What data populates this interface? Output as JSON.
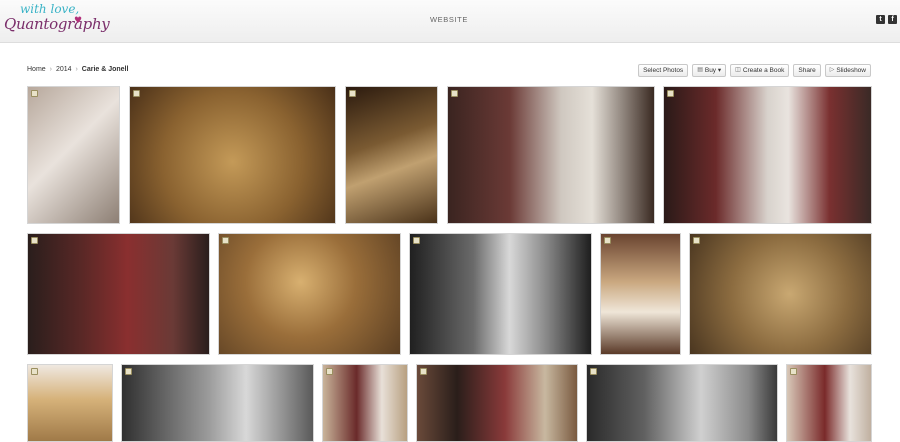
{
  "header": {
    "logo_line1": "with love,",
    "logo_line2": "Quantography",
    "nav_label": "WEBSITE",
    "social": [
      {
        "icon": "twitter-icon",
        "glyph": "t"
      },
      {
        "icon": "facebook-icon",
        "glyph": "f"
      }
    ]
  },
  "breadcrumb": {
    "home": "Home",
    "year": "2014",
    "gallery": "Carie & Jonell",
    "separator": "›"
  },
  "toolbar": {
    "select_photos": "Select Photos",
    "buy": "Buy ▾",
    "create_book": "Create a Book",
    "share": "Share",
    "slideshow": "Slideshow"
  },
  "colors": {
    "logo_teal": "#3ab3c6",
    "logo_plum": "#7b2f6b",
    "button_border": "#c8c8c8"
  },
  "photos": [
    {
      "name": "photo-bridal-shoes",
      "bg": "linear-gradient(135deg,#b7a89c 0%,#e9e2dc 45%,#8d7f74 100%)"
    },
    {
      "name": "photo-earrings-on-fabric",
      "bg": "radial-gradient(circle at 50% 55%,#c49a58 0%,#8a6230 55%,#4a3018 100%)"
    },
    {
      "name": "photo-jeweled-clutch",
      "bg": "linear-gradient(160deg,#2b1a0e 0%,#7a5a32 40%,#c0a070 60%,#4a3219 100%)"
    },
    {
      "name": "photo-bridesmaid-and-bride-closet",
      "bg": "linear-gradient(90deg,#3a2420 0%,#6b3a36 30%,#cfc8c0 55%,#e5e0d8 70%,#3a2a22 100%)"
    },
    {
      "name": "photo-bridesmaids-dressing",
      "bg": "linear-gradient(90deg,#2a1a18 0%,#6b2a2a 25%,#d8d2cc 50%,#e9e4df 60%,#7a3030 80%,#3a2a26 100%)"
    },
    {
      "name": "photo-bridesmaid-red-dress",
      "bg": "linear-gradient(90deg,#2a1e1c 0%,#5a2826 30%,#8a2f2f 55%,#6a3a36 80%,#2a1e1c 100%)"
    },
    {
      "name": "photo-sparkling-detail-one",
      "bg": "radial-gradient(circle at 45% 40%,#d8b070 0%,#9a6e3a 45%,#5a3e22 100%)"
    },
    {
      "name": "photo-bw-bride-helping",
      "bg": "linear-gradient(90deg,#202020 0%,#6a6a6a 35%,#d8d8d8 55%,#8a8a8a 75%,#1e1e1e 100%)"
    },
    {
      "name": "photo-wedding-gown-hanging",
      "bg": "linear-gradient(180deg,#6a4430 0%,#caa880 40%,#efe6d8 65%,#5a3a28 100%)"
    },
    {
      "name": "photo-sparkling-detail-two",
      "bg": "radial-gradient(circle at 55% 50%,#c9a872 0%,#8c6c40 50%,#4a3620 100%)"
    },
    {
      "name": "photo-gown-bodice",
      "bg": "linear-gradient(180deg,#efe8e0 0%,#d6b27a 45%,#a07a48 100%)"
    },
    {
      "name": "photo-bw-bride-seated",
      "bg": "linear-gradient(90deg,#303030 0%,#9a9a9a 45%,#d8d8d8 65%,#5a5a5a 100%)"
    },
    {
      "name": "photo-bride-and-flower-girl",
      "bg": "linear-gradient(90deg,#c9b49a 0%,#6a2a2a 40%,#e8e0d8 70%,#b8a080 100%)"
    },
    {
      "name": "photo-family-group",
      "bg": "linear-gradient(90deg,#6a4a3a 0%,#2a1e1a 25%,#8a3a3a 55%,#c8b8a0 80%,#7a5a40 100%)"
    },
    {
      "name": "photo-bw-bride-getting-ready",
      "bg": "linear-gradient(90deg,#2a2a2a 0%,#606060 30%,#d0d0d0 60%,#8a8a8a 85%,#3a3a3a 100%)"
    },
    {
      "name": "photo-bridesmaids-group",
      "bg": "linear-gradient(90deg,#d8c8b8 0%,#7a2a2a 45%,#e8e2dc 75%,#c0b0a0 100%)"
    }
  ]
}
